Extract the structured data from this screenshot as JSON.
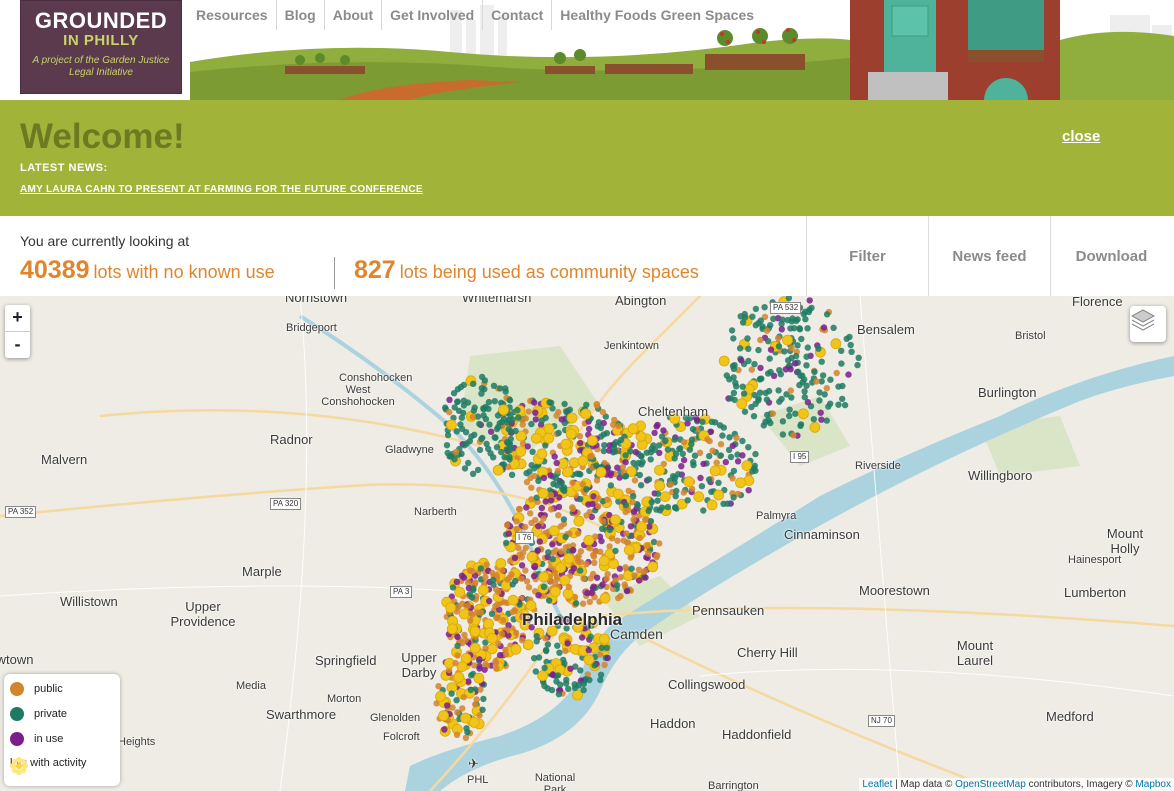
{
  "logo": {
    "line1": "GROUNDED",
    "line2": "IN PHILLY",
    "tagline": "A project of the Garden Justice Legal Initiative"
  },
  "nav": [
    "Resources",
    "Blog",
    "About",
    "Get Involved",
    "Contact",
    "Healthy Foods Green Spaces"
  ],
  "welcome": {
    "title": "Welcome!",
    "news_label": "LATEST NEWS:",
    "news_link": "AMY LAURA CAHN TO PRESENT AT FARMING FOR THE FUTURE CONFERENCE",
    "close": "close"
  },
  "stats": {
    "intro": "You are currently looking at",
    "vacant_count": "40389",
    "vacant_text": "lots with no known use",
    "community_count": "827",
    "community_text": "lots being used as community spaces"
  },
  "tabs": [
    "Filter",
    "News feed",
    "Download"
  ],
  "map": {
    "zoom_in": "+",
    "zoom_out": "-",
    "places": [
      "Norristown",
      "Whitemarsh",
      "Abington",
      "Florence",
      "Bridgeport",
      "Bensalem",
      "Bristol",
      "Jenkintown",
      "Conshohocken",
      "West Conshohocken",
      "Burlington",
      "Cheltenham",
      "Radnor",
      "Gladwyne",
      "Riverside",
      "Malvern",
      "Willingboro",
      "Narberth",
      "Palmyra",
      "Cinnaminson",
      "Mount Holly",
      "Hainesport",
      "Marple",
      "Moorestown",
      "Willistown",
      "Upper Providence",
      "Philadelphia",
      "Camden",
      "Pennsauken",
      "Lumberton",
      "Springfield",
      "Upper Darby",
      "Cherry Hill",
      "Mount Laurel",
      "Media",
      "Collingswood",
      "Morton",
      "Swarthmore",
      "Glenolden",
      "Haddon",
      "Haddonfield",
      "Medford",
      "Folcroft",
      "PHL",
      "National Park",
      "Barrington",
      "Newtown",
      "Heights"
    ],
    "shields": [
      "PA 532",
      "I 95",
      "PA 352",
      "PA 320",
      "I 76",
      "PA 3",
      "NJ 70"
    ],
    "colors": {
      "public": "#d4842a",
      "private": "#1e7b63",
      "in_use": "#7a1e8c",
      "activity": "#f0c419",
      "welcome_band": "#a2b33a",
      "stat_orange": "#e0852c"
    }
  },
  "legend": [
    {
      "label": "public",
      "color": "#d4842a",
      "icon": "circle-icon"
    },
    {
      "label": "private",
      "color": "#1e7b63",
      "icon": "circle-icon"
    },
    {
      "label": "in use",
      "color": "#7a1e8c",
      "icon": "circle-icon"
    },
    {
      "label": "lots with activity",
      "color": "#f0c419",
      "icon": "sunflower-icon"
    }
  ],
  "attribution": {
    "leaflet": "Leaflet",
    "map_data": "| Map data ©",
    "osm": "OpenStreetMap",
    "contrib": "contributors, Imagery ©",
    "mapbox": "Mapbox"
  }
}
